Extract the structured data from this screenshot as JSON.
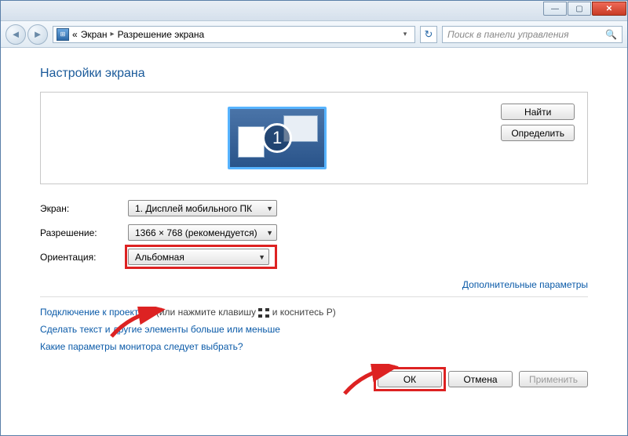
{
  "window": {
    "minimize": "—",
    "maximize": "▢",
    "close": "✕"
  },
  "breadcrumb": {
    "prefix": "«",
    "item1": "Экран",
    "item2": "Разрешение экрана"
  },
  "search": {
    "placeholder": "Поиск в панели управления",
    "icon": "🔍"
  },
  "page": {
    "title": "Настройки экрана",
    "display_number": "1"
  },
  "sidebuttons": {
    "find": "Найти",
    "detect": "Определить"
  },
  "form": {
    "display_label": "Экран:",
    "display_value": "1. Дисплей мобильного ПК",
    "resolution_label": "Разрешение:",
    "resolution_value": "1366 × 768 (рекомендуется)",
    "orientation_label": "Ориентация:",
    "orientation_value": "Альбомная"
  },
  "links": {
    "advanced": "Дополнительные параметры",
    "projector_link": "Подключение к проектору",
    "projector_rest1": " (или нажмите клавишу ",
    "projector_rest2": " и коснитесь P)",
    "textsize": "Сделать текст и другие элементы больше или меньше",
    "whichmonitor": "Какие параметры монитора следует выбрать?"
  },
  "actions": {
    "ok": "ОК",
    "cancel": "Отмена",
    "apply": "Применить"
  }
}
